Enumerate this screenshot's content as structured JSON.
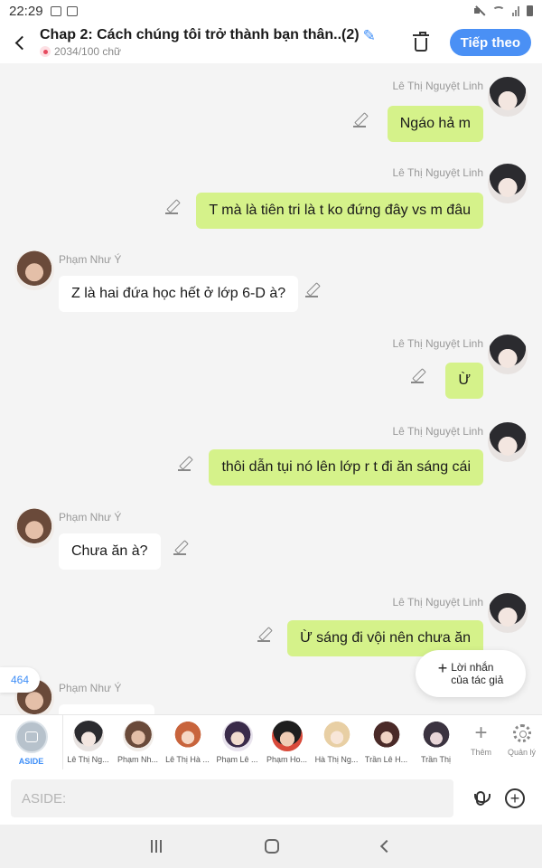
{
  "status_bar": {
    "time": "22:29"
  },
  "header": {
    "title": "Chap 2: Cách chúng tôi trở thành bạn thân..(2)",
    "word_count": "2034/100 chữ",
    "follow_label": "Tiếp theo"
  },
  "messages": [
    {
      "side": "right",
      "author": "Lê Thị Nguyệt Linh",
      "text": "Ngáo hả m"
    },
    {
      "side": "right",
      "author": "Lê Thị Nguyệt Linh",
      "text": "T mà là tiên tri là t ko đứng đây vs m đâu"
    },
    {
      "side": "left",
      "author": "Phạm Như Ý",
      "text": "Z là hai đứa học hết ở lớp 6-D à?"
    },
    {
      "side": "right",
      "author": "Lê Thị Nguyệt Linh",
      "text": "Ừ"
    },
    {
      "side": "right",
      "author": "Lê Thị Nguyệt Linh",
      "text": "thôi dẫn tụi nó lên lớp r t đi ăn sáng cái"
    },
    {
      "side": "left",
      "author": "Phạm Như Ý",
      "text": "Chưa ăn à?"
    },
    {
      "side": "right",
      "author": "Lê Thị Nguyệt Linh",
      "text": "Ừ sáng đi vội nên chưa ăn"
    },
    {
      "side": "left",
      "author": "Phạm Như Ý",
      "text": ""
    }
  ],
  "count_badge": "464",
  "author_note": {
    "line1": "Lời nhắn",
    "line2": "của tác giả"
  },
  "characters": {
    "aside_label": "ASIDE",
    "items": [
      "Lê Thị Ng...",
      "Phạm Nh...",
      "Lê Thị Hà ...",
      "Phạm Lê ...",
      "Phạm Ho...",
      "Hà Thị Ng...",
      "Trần Lê H...",
      "Trần Thị"
    ],
    "add_label": "Thêm",
    "manage_label": "Quản lý"
  },
  "input": {
    "placeholder": "ASIDE:"
  },
  "colors": {
    "accent": "#4a90f5",
    "bubble_right": "#d5f28a",
    "bubble_left": "#ffffff"
  }
}
